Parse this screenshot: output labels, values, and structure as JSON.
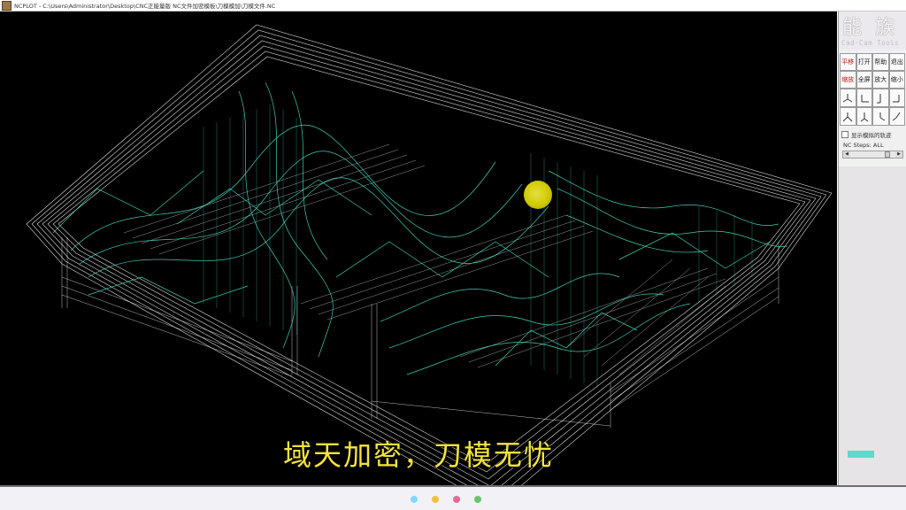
{
  "window": {
    "title": "NCPLOT - C:\\Users\\Administrator\\Desktop\\CNC正能量版 NC文件加密模板\\刀模模加\\刀模文件.NC"
  },
  "panel": {
    "logo_cn": "能 族",
    "logo_en": "Cad·Cam Tools",
    "buttons": [
      {
        "label": "平移",
        "color": "red"
      },
      {
        "label": "打开",
        "color": "black"
      },
      {
        "label": "帮助",
        "color": "black"
      },
      {
        "label": "退出",
        "color": "black"
      },
      {
        "label": "缩放",
        "color": "red"
      },
      {
        "label": "全屏",
        "color": "black"
      },
      {
        "label": "放大",
        "color": "black"
      },
      {
        "label": "缩小",
        "color": "black"
      }
    ],
    "view_icons": [
      "axis-iso-icon",
      "axis-front-icon",
      "axis-side-icon",
      "axis-rear-icon",
      "axis-top-icon",
      "axis-iso2-icon",
      "axis-left-icon",
      "axis-right-icon"
    ],
    "checkbox_label": "显示模拟的轨迹",
    "nc_steps_label": "NC Steps: ALL"
  },
  "viewport": {
    "subtitle": "域天加密，刀模无忧"
  },
  "colors": {
    "toolpath": "#44e3c7",
    "outline": "#ffffff",
    "subtitle": "#f4e43e",
    "cursor": "#e8e000"
  }
}
